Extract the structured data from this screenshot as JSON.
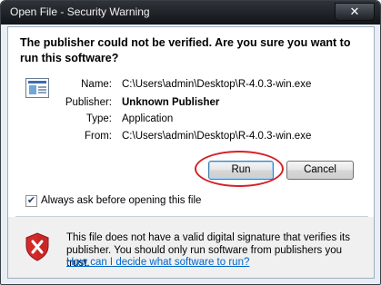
{
  "window": {
    "title": "Open File - Security Warning",
    "close_glyph": "✕"
  },
  "dialog": {
    "heading": "The publisher could not be verified.  Are you sure you want to run this software?",
    "file_icon": "application-file-icon",
    "fields": [
      {
        "label": "Name:",
        "value": "C:\\Users\\admin\\Desktop\\R-4.0.3-win.exe",
        "bold": false
      },
      {
        "label": "Publisher:",
        "value": "Unknown Publisher",
        "bold": true
      },
      {
        "label": "Type:",
        "value": "Application",
        "bold": false
      },
      {
        "label": "From:",
        "value": "C:\\Users\\admin\\Desktop\\R-4.0.3-win.exe",
        "bold": false
      }
    ],
    "run_label": "Run",
    "cancel_label": "Cancel",
    "checkbox_label": "Always ask before opening this file",
    "checkbox_checked": true,
    "check_glyph": "✔",
    "warning_text": "This file does not have a valid digital signature that verifies its publisher.  You should only run software from publishers you trust.",
    "help_link": "How can I decide what software to run?",
    "shield_icon": "shield-error-icon",
    "colors": {
      "link": "#0066cc",
      "highlight": "#d62024",
      "shield_red": "#d52a2a"
    }
  }
}
